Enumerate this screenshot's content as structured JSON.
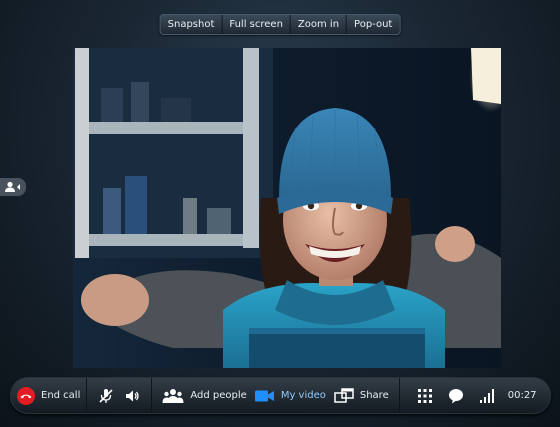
{
  "top_toolbar": {
    "buttons": [
      {
        "label": "Snapshot"
      },
      {
        "label": "Full screen"
      },
      {
        "label": "Zoom in"
      },
      {
        "label": "Pop-out"
      }
    ]
  },
  "bottom_bar": {
    "end_call_label": "End call",
    "add_people_label": "Add people",
    "my_video_label": "My video",
    "share_label": "Share",
    "call_duration": "00:27"
  },
  "colors": {
    "end_call": "#e31b23",
    "video_active": "#1f8fff",
    "active_label": "#8fc9ff"
  }
}
